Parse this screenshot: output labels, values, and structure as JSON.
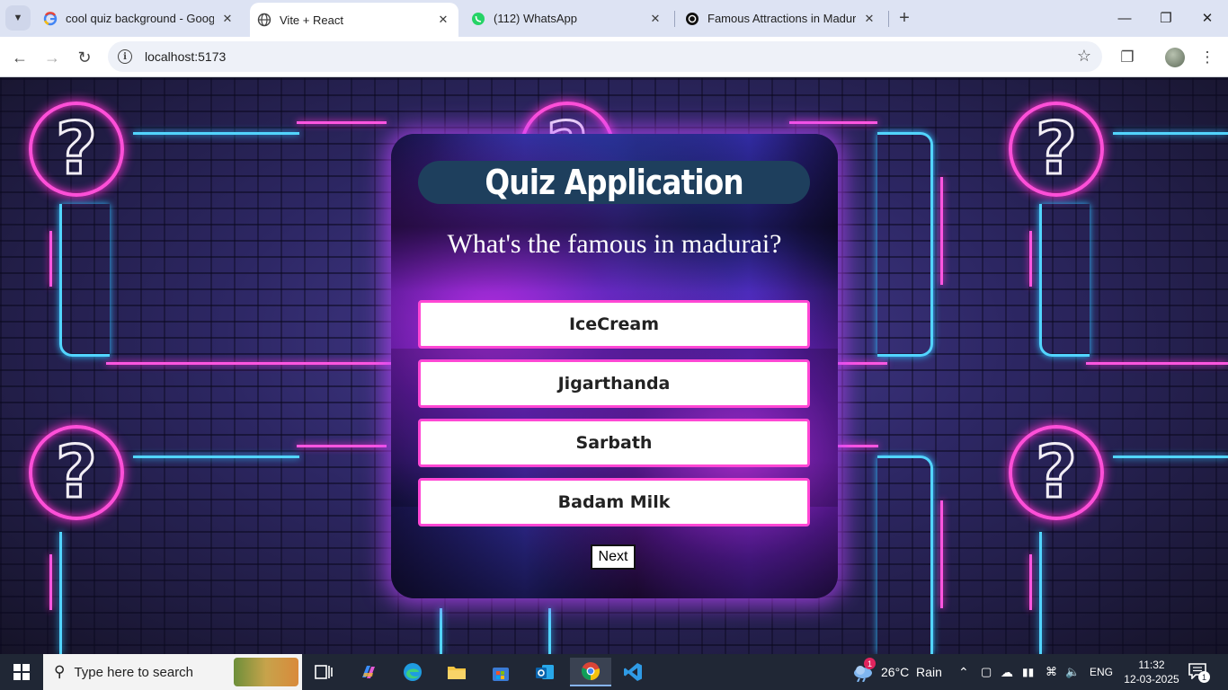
{
  "browser": {
    "tabs": [
      {
        "title": "cool quiz background - Google",
        "favicon": "google-g-icon",
        "active": false
      },
      {
        "title": "Vite + React",
        "favicon": "globe-icon",
        "active": true
      },
      {
        "title": "(112) WhatsApp",
        "favicon": "whatsapp-icon",
        "active": false
      },
      {
        "title": "Famous Attractions in Madurai",
        "favicon": "chatgpt-icon",
        "active": false
      }
    ],
    "address": "localhost:5173"
  },
  "quiz": {
    "title": "Quiz Application",
    "question": "What's the famous in madurai?",
    "options": [
      "IceCream",
      "Jigarthanda",
      "Sarbath",
      "Badam Milk"
    ],
    "next_label": "Next"
  },
  "taskbar": {
    "search_placeholder": "Type here to search",
    "weather": "26°C  Rain",
    "weather_badge": "1",
    "language": "ENG",
    "time": "11:32",
    "date": "12-03-2025",
    "notification_count": "1"
  },
  "colors": {
    "neon_pink": "#ff4fd8",
    "neon_blue": "#52d5ff",
    "title_bar": "#1e3f5d",
    "option_border": "#ff47d4"
  }
}
